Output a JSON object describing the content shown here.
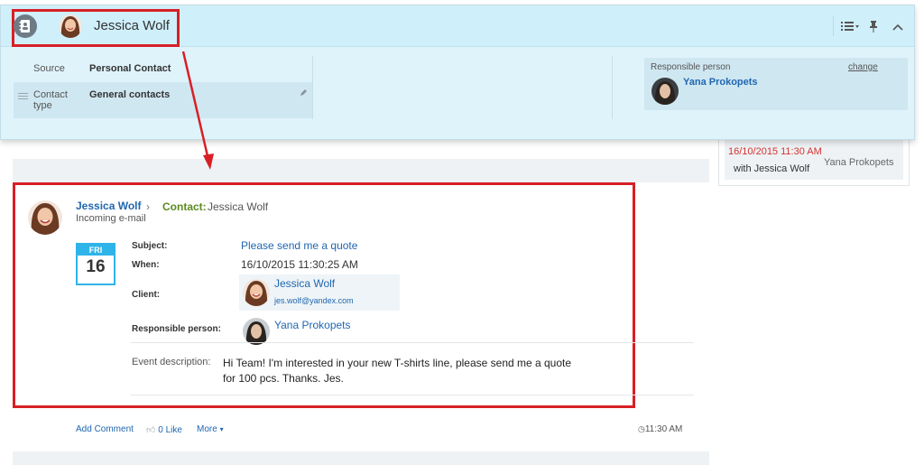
{
  "contact_card": {
    "name": "Jessica Wolf",
    "fields": {
      "source_label": "Source",
      "source_value": "Personal Contact",
      "contact_type_label": "Contact type",
      "contact_type_value": "General contacts"
    },
    "responsible": {
      "label": "Responsible person",
      "change_label": "change",
      "name": "Yana Prokopets"
    }
  },
  "side_activity": {
    "datetime": "16/10/2015 11:30 AM",
    "with_text": "with Jessica Wolf",
    "person": "Yana Prokopets"
  },
  "event": {
    "author": "Jessica Wolf",
    "contact_label": "Contact:",
    "contact_name": "Jessica Wolf",
    "type": "Incoming e-mail",
    "calendar": {
      "weekday": "FRI",
      "day": "16"
    },
    "subject_label": "Subject:",
    "subject_value": "Please send me a quote",
    "when_label": "When:",
    "when_value": "16/10/2015 11:30:25 AM",
    "client_label": "Client:",
    "client_name": "Jessica Wolf",
    "client_email": "jes.wolf@yandex.com",
    "responsible_label": "Responsible person:",
    "responsible_name": "Yana Prokopets",
    "description_label": "Event description:",
    "description_text": "Hi Team! I'm interested in your new T-shirts line, please send me a quote for 100 pcs. Thanks. Jes."
  },
  "footer": {
    "add_comment": "Add Comment",
    "like_count": "0",
    "like_label": "Like",
    "more_label": "More",
    "time": "11:30 AM"
  },
  "colors": {
    "highlight_red": "#d81f26",
    "link_blue": "#2067b0",
    "card_blue": "#dff3fb"
  }
}
